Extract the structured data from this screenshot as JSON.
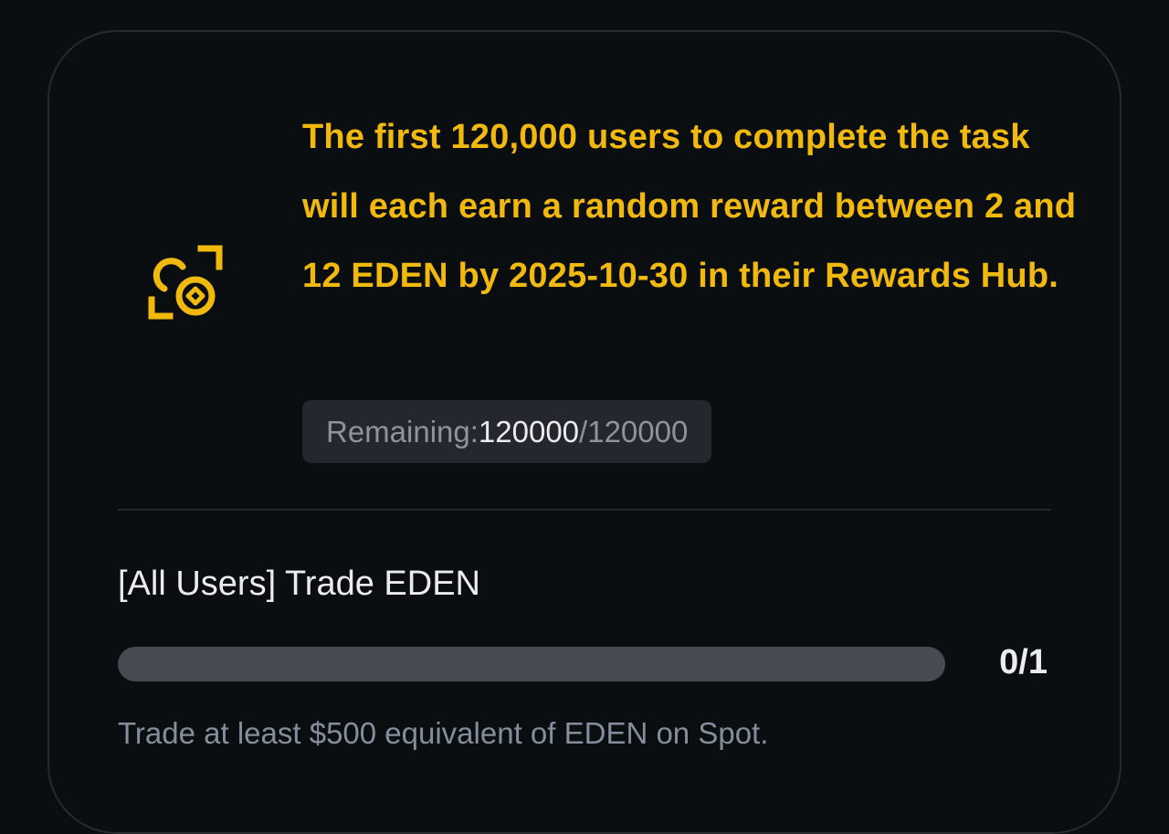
{
  "theme": {
    "accent": "#f0b90b",
    "background": "#0b0e11",
    "text_primary": "#eaecef",
    "text_secondary": "#848e9c"
  },
  "reward": {
    "icon": "coin-scan-icon",
    "description": "The first 120,000 users to complete the task will each earn a random reward between 2 and 12 EDEN by 2025-10-30 in their Rewards Hub.",
    "remaining_label": "Remaining: ",
    "remaining_current": "120000",
    "remaining_total": "/120000"
  },
  "task": {
    "title": "[All Users] Trade EDEN",
    "progress_fraction": 0,
    "progress_text": "0/1",
    "description": "Trade at least $500 equivalent of EDEN on Spot."
  }
}
